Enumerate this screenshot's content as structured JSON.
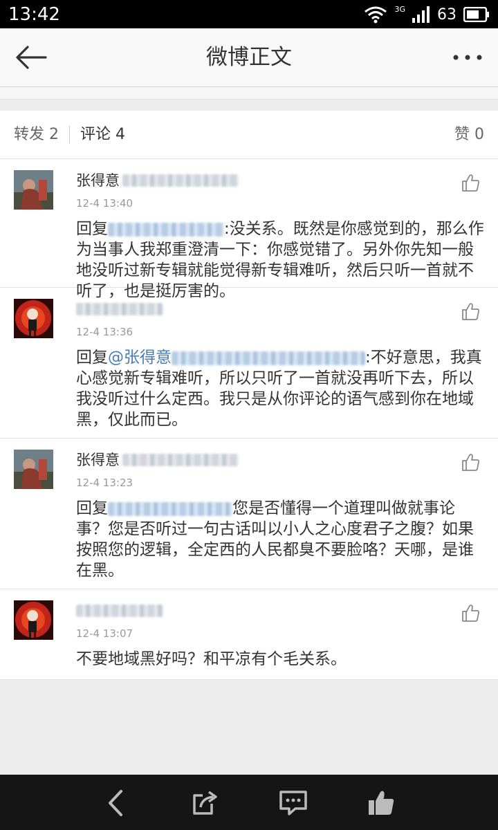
{
  "status_bar": {
    "time": "13:42",
    "network": "3G",
    "battery": "63"
  },
  "header": {
    "title": "微博正文",
    "back_icon": "arrow-left-icon",
    "more_icon": "more-dots-icon"
  },
  "tabs": {
    "repost_label": "转发 2",
    "comment_label": "评论 4",
    "like_label": "赞 0"
  },
  "comments": [
    {
      "author": "张得意",
      "author_blurred": true,
      "time": "12-4 13:40",
      "reply_prefix": "回复",
      "mention": "",
      "mention_blurred": true,
      "body": ":没关系。既然是你感觉到的，那么作为当事人我郑重澄清一下：你感觉错了。另外你先知一般地没听过新专辑就能觉得新专辑难听，然后只听一首就不听了，也是挺厉害的。"
    },
    {
      "author": "",
      "author_blurred": true,
      "time": "12-4 13:36",
      "reply_prefix": "回复",
      "mention": "@张得意",
      "mention_blurred": true,
      "body": ":不好意思，我真心感觉新专辑难听，所以只听了一首就没再听下去，所以我没听过什么定西。我只是从你评论的语气感到你在地域黑，仅此而已。"
    },
    {
      "author": "张得意",
      "author_blurred": true,
      "time": "12-4 13:23",
      "reply_prefix": "回复",
      "mention": "",
      "mention_blurred": true,
      "body": "您是否懂得一个道理叫做就事论事？您是否听过一句古话叫以小人之心度君子之腹？如果按照您的逻辑，全定西的人民都臭不要脸咯？天哪，是谁在黑。"
    },
    {
      "author": "",
      "author_blurred": true,
      "time": "12-4 13:07",
      "reply_prefix": "",
      "mention": "",
      "mention_blurred": false,
      "body": "不要地域黑好吗？和平凉有个毛关系。"
    }
  ],
  "bottom_nav": {
    "icons": [
      "back-chevron-icon",
      "share-icon",
      "comment-icon",
      "thumbs-up-icon"
    ]
  }
}
